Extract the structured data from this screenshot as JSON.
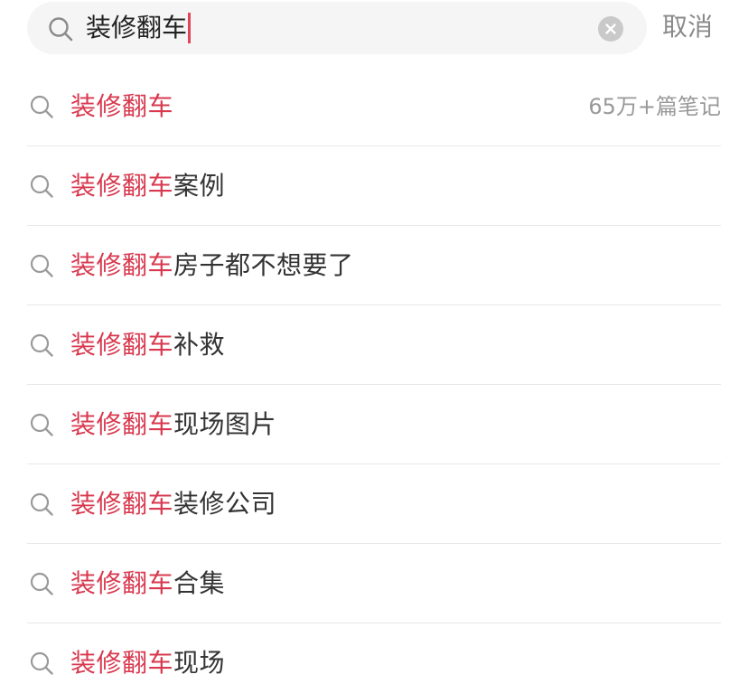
{
  "search": {
    "query": "装修翻车",
    "cancel_label": "取消"
  },
  "suggestions": [
    {
      "highlight": "装修翻车",
      "rest": "",
      "meta": "65万+篇笔记"
    },
    {
      "highlight": "装修翻车",
      "rest": "案例",
      "meta": ""
    },
    {
      "highlight": "装修翻车",
      "rest": "房子都不想要了",
      "meta": ""
    },
    {
      "highlight": "装修翻车",
      "rest": "补救",
      "meta": ""
    },
    {
      "highlight": "装修翻车",
      "rest": "现场图片",
      "meta": ""
    },
    {
      "highlight": "装修翻车",
      "rest": "装修公司",
      "meta": ""
    },
    {
      "highlight": "装修翻车",
      "rest": "合集",
      "meta": ""
    },
    {
      "highlight": "装修翻车",
      "rest": "现场",
      "meta": ""
    }
  ],
  "icons": {
    "search": "search-icon",
    "clear": "clear-icon"
  },
  "colors": {
    "highlight": "#d8394f",
    "caret": "#e0455a",
    "text": "#333333",
    "muted": "#999999",
    "search_bg": "#f5f5f5"
  }
}
